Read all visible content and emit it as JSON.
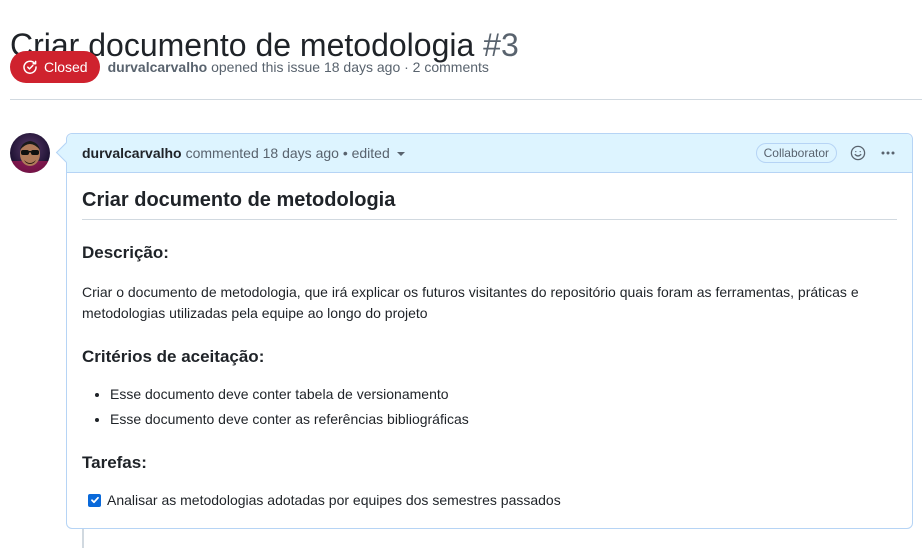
{
  "issue": {
    "title": "Criar documento de metodologia",
    "number": "#3",
    "state_label": "Closed",
    "author": "durvalcarvalho",
    "meta_text": "opened this issue 18 days ago · 2 comments"
  },
  "comment": {
    "author": "durvalcarvalho",
    "meta_text": "commented 18 days ago • edited",
    "role_badge": "Collaborator",
    "heading": "Criar documento de metodologia",
    "sections": {
      "descricao_title": "Descrição:",
      "descricao_text": "Criar o documento de metodologia, que irá explicar os futuros visitantes do repositório quais foram as ferramentas, práticas e metodologias utilizadas pela equipe ao longo do projeto",
      "criterios_title": "Critérios de aceitação:",
      "criterios_items": [
        "Esse documento deve conter tabela de versionamento",
        "Esse documento deve conter as referências bibliográficas"
      ],
      "tarefas_title": "Tarefas:",
      "tarefas_items": [
        {
          "label": "Analisar as metodologias adotadas por equipes dos semestres passados",
          "checked": true
        }
      ]
    }
  },
  "colors": {
    "closed": "#cf222e",
    "header_bg": "#ddf4ff",
    "border_blue": "#b6d4f5",
    "checkbox": "#0969da"
  },
  "icons": {
    "state": "issue-closed-icon",
    "reaction": "smiley-icon",
    "more": "kebab-horizontal-icon",
    "edited_caret": "triangle-down-icon"
  }
}
